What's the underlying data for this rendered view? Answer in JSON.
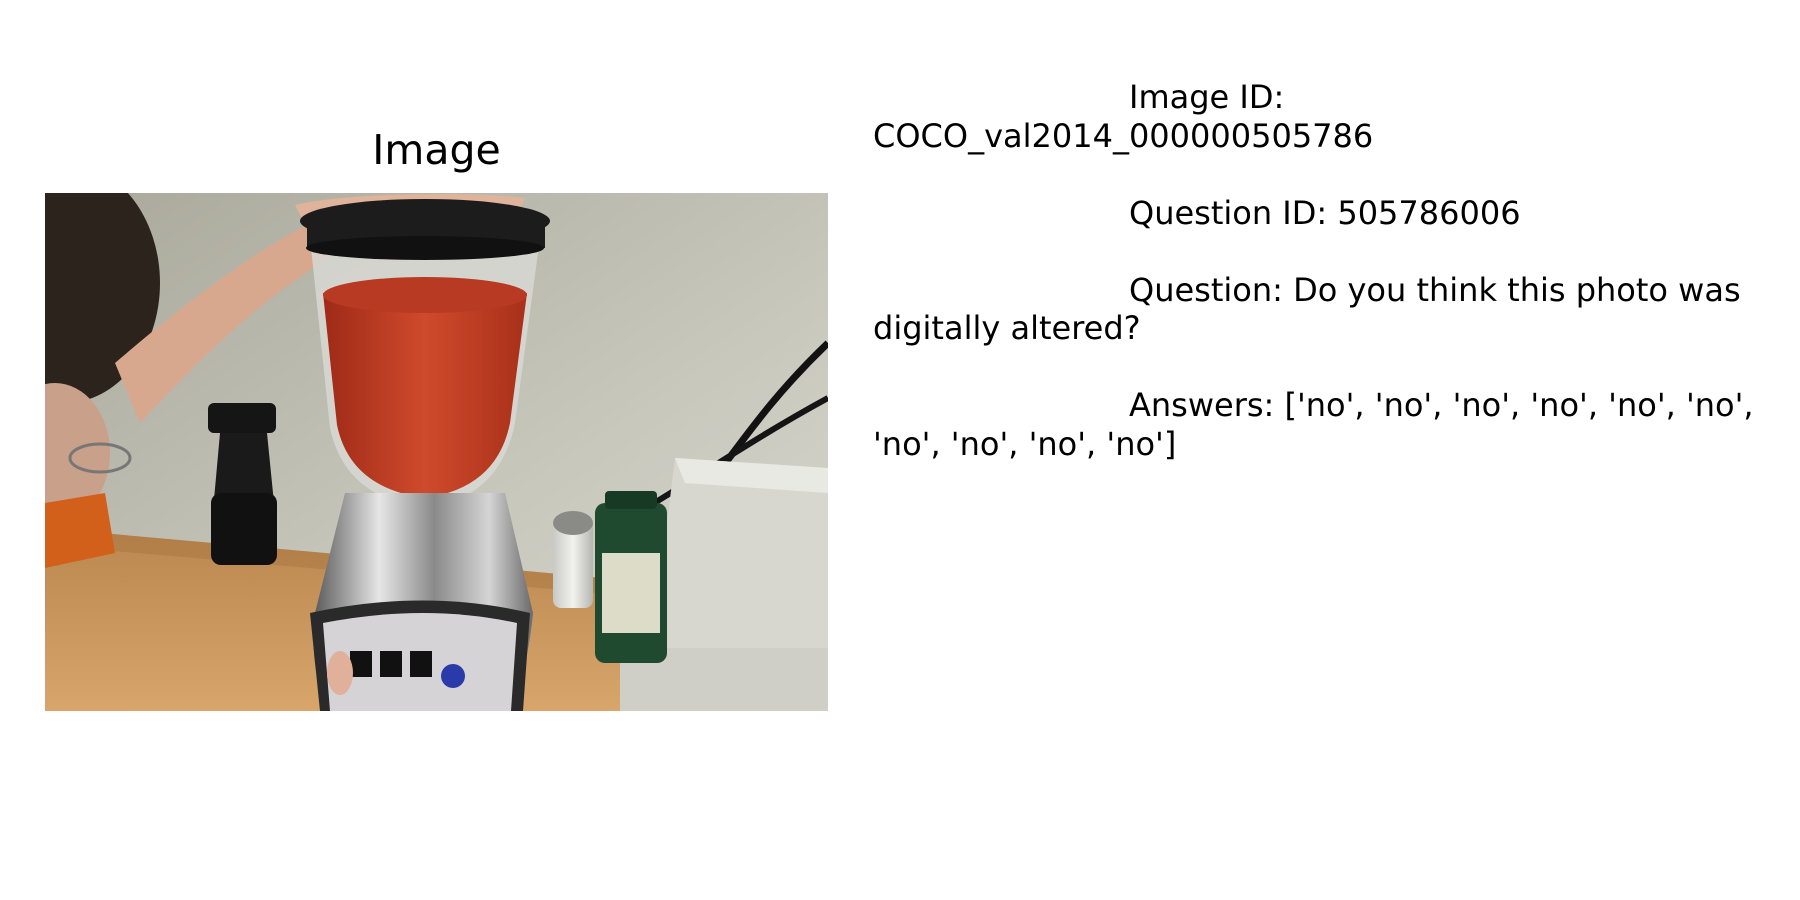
{
  "panel": {
    "title": "Image"
  },
  "photo": {
    "icon": "photo-blender-icon",
    "colors": {
      "wall": "#b9b8aa",
      "counter": "#c8955a",
      "sauce": "#c23a22",
      "blender_base": "#a9a9a9",
      "lid": "#1c1c1c"
    }
  },
  "info": {
    "image_id": "Image ID: COCO_val2014_000000505786",
    "question_id": "Question ID: 505786006",
    "question": "Question: Do you think this photo was digitally altered?",
    "answers": "Answers: ['no', 'no', 'no', 'no', 'no', 'no', 'no', 'no', 'no', 'no']"
  }
}
